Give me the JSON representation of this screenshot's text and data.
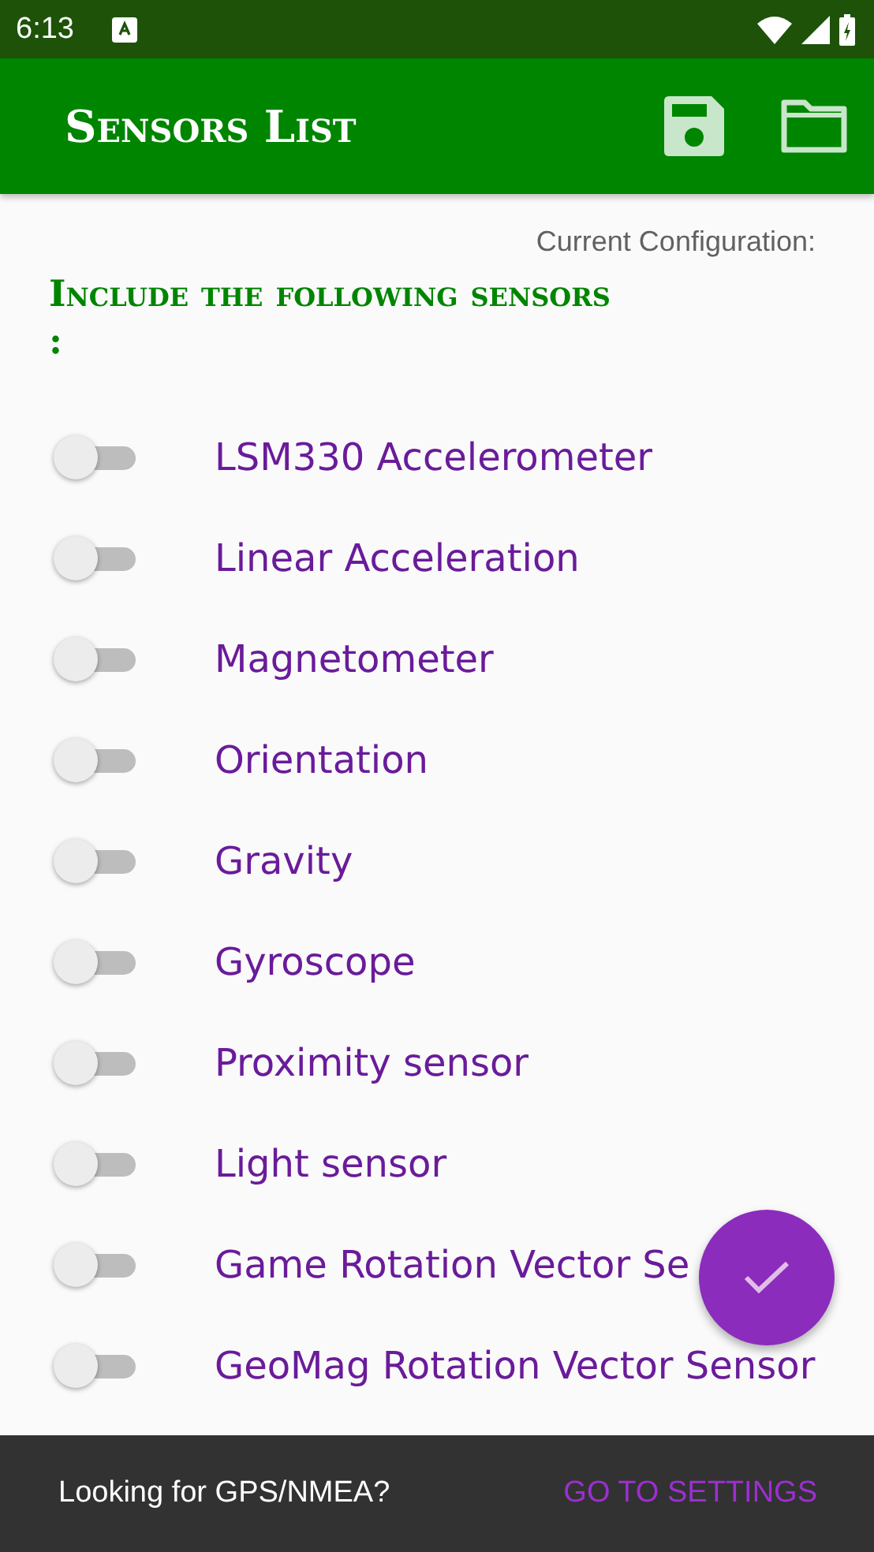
{
  "status_bar": {
    "time": "6:13"
  },
  "app_bar": {
    "title": "Sensors List"
  },
  "config_label": "Current Configuration:",
  "heading": "Include the following sensors :",
  "sensors": [
    {
      "name": "LSM330 Accelerometer",
      "checked": false
    },
    {
      "name": "Linear Acceleration",
      "checked": false
    },
    {
      "name": "Magnetometer",
      "checked": false
    },
    {
      "name": "Orientation",
      "checked": false
    },
    {
      "name": "Gravity",
      "checked": false
    },
    {
      "name": "Gyroscope",
      "checked": false
    },
    {
      "name": "Proximity sensor",
      "checked": false
    },
    {
      "name": "Light sensor",
      "checked": false
    },
    {
      "name": "Game Rotation Vector Se",
      "checked": false
    },
    {
      "name": "GeoMag Rotation Vector Sensor",
      "checked": false
    }
  ],
  "snackbar": {
    "message": "Looking for GPS/NMEA?",
    "action": "GO TO SETTINGS"
  }
}
